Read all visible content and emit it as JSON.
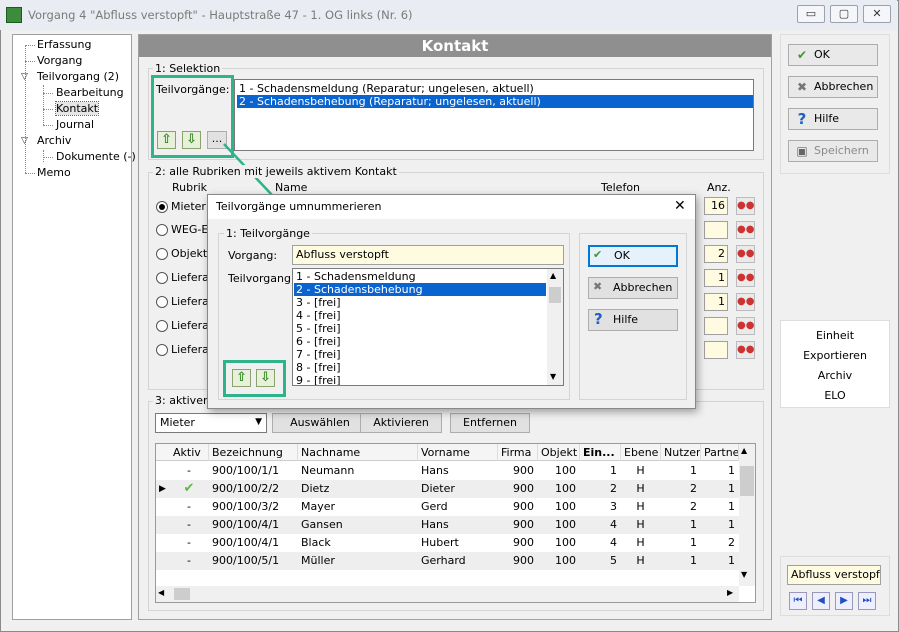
{
  "window": {
    "title": "Vorgang 4 \"Abfluss verstopft\" - Hauptstraße 47 - 1. OG links (Nr. 6)",
    "min_glyph": "▭",
    "max_glyph": "▢",
    "close_glyph": "✕"
  },
  "nav": {
    "items": [
      "Erfassung",
      "Vorgang",
      "Teilvorgang (2)",
      "Bearbeitung",
      "Kontakt",
      "Journal",
      "Archiv",
      "Dokumente (-)",
      "Memo"
    ]
  },
  "header": {
    "title": "Kontakt"
  },
  "selektion": {
    "group_label": "1: Selektion",
    "teilvorgaenge_label": "Teilvorgänge:",
    "items": [
      "1 - Schadensmeldung (Reparatur;  ungelesen, aktuell)",
      "2 - Schadensbehebung (Reparatur;  ungelesen, aktuell)"
    ],
    "selected_index": 1,
    "more_label": "..."
  },
  "rubriken": {
    "group_label": "2: alle Rubriken mit jeweils aktivem Kontakt",
    "col_rubrik": "Rubrik",
    "col_name": "Name",
    "col_telefon": "Telefon",
    "col_anz": "Anz.",
    "rows": [
      {
        "label": "Mieter:",
        "anz": "16",
        "checked": true
      },
      {
        "label": "WEG-Ei",
        "anz": "",
        "checked": false
      },
      {
        "label": "Objekt-E",
        "anz": "2",
        "checked": false
      },
      {
        "label": "Lieferan",
        "anz": "1",
        "checked": false
      },
      {
        "label": "Lieferan",
        "anz": "1",
        "checked": false
      },
      {
        "label": "Lieferan",
        "anz": "",
        "checked": false
      },
      {
        "label": "Lieferan",
        "anz": "",
        "checked": false
      }
    ]
  },
  "aktiv": {
    "group_label": "3: aktiver K",
    "dropdown_value": "Mieter",
    "btn_auswaehlen": "Auswählen",
    "btn_aktivieren": "Aktivieren",
    "btn_entfernen": "Entfernen",
    "columns": [
      "Aktiv",
      "Bezeichnung",
      "Nachname",
      "Vorname",
      "Firma",
      "Objekt",
      "Ein...",
      "Ebene",
      "Nutzer",
      "Partne"
    ],
    "rows": [
      {
        "aktiv": "-",
        "bez": "900/100/1/1",
        "nach": "Neumann",
        "vor": "Hans",
        "firma": "900",
        "objekt": "100",
        "ein": "1",
        "ebene": "H",
        "nutzer": "1",
        "partner": "1",
        "current": false
      },
      {
        "aktiv": "✔",
        "bez": "900/100/2/2",
        "nach": "Dietz",
        "vor": "Dieter",
        "firma": "900",
        "objekt": "100",
        "ein": "2",
        "ebene": "H",
        "nutzer": "2",
        "partner": "1",
        "current": true
      },
      {
        "aktiv": "-",
        "bez": "900/100/3/2",
        "nach": "Mayer",
        "vor": "Gerd",
        "firma": "900",
        "objekt": "100",
        "ein": "3",
        "ebene": "H",
        "nutzer": "2",
        "partner": "1",
        "current": false
      },
      {
        "aktiv": "-",
        "bez": "900/100/4/1",
        "nach": "Gansen",
        "vor": "Hans",
        "firma": "900",
        "objekt": "100",
        "ein": "4",
        "ebene": "H",
        "nutzer": "1",
        "partner": "1",
        "current": false
      },
      {
        "aktiv": "-",
        "bez": "900/100/4/1",
        "nach": "Black",
        "vor": "Hubert",
        "firma": "900",
        "objekt": "100",
        "ein": "4",
        "ebene": "H",
        "nutzer": "1",
        "partner": "2",
        "current": false
      },
      {
        "aktiv": "-",
        "bez": "900/100/5/1",
        "nach": "Müller",
        "vor": "Gerhard",
        "firma": "900",
        "objekt": "100",
        "ein": "5",
        "ebene": "H",
        "nutzer": "1",
        "partner": "1",
        "current": false
      }
    ]
  },
  "right": {
    "ok": "OK",
    "abbrechen": "Abbrechen",
    "hilfe": "Hilfe",
    "speichern": "Speichern",
    "list": [
      "Einheit",
      "Exportieren",
      "Archiv",
      "ELO"
    ],
    "bottom_field": "Abfluss verstopft"
  },
  "dialog": {
    "title": "Teilvorgänge umnummerieren",
    "group_label": "1: Teilvorgänge",
    "vorgang_label": "Vorgang:",
    "vorgang_value": "Abfluss verstopft",
    "teilvorgang_label": "Teilvorgang:",
    "items": [
      "1 - Schadensmeldung",
      "2 - Schadensbehebung",
      "3 - [frei]",
      "4 - [frei]",
      "5 - [frei]",
      "6 - [frei]",
      "7 - [frei]",
      "8 - [frei]",
      "9 - [frei]"
    ],
    "selected_index": 1,
    "ok": "OK",
    "abbrechen": "Abbrechen",
    "hilfe": "Hilfe"
  },
  "colors": {
    "accent": "#2fb38a",
    "selection": "#0a64d0",
    "header": "#8f8f8f"
  }
}
